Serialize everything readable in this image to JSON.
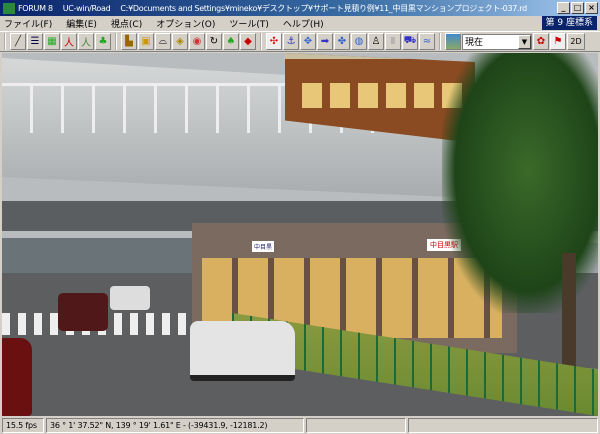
{
  "window": {
    "app": "FORUM 8",
    "product": "UC-win/Road",
    "path": "C:¥Documents and Settings¥mineko¥デスクトップ¥サポート見積り例¥11_中目黒マンションプロジェクト-037.rd",
    "min": "_",
    "max": "□",
    "close": "×"
  },
  "menu": [
    "ファイル(F)",
    "編集(E)",
    "視点(C)",
    "オプション(O)",
    "ツール(T)",
    "ヘルプ(H)"
  ],
  "coord_system": "第 9 座標系",
  "toolbar": {
    "group1": [
      "road-icon",
      "bridge-icon",
      "terrain-icon",
      "person-red-icon",
      "person-walk-icon",
      "tree-icon"
    ],
    "group2": [
      "building-icon",
      "model-icon",
      "tunnel-icon",
      "object-icon",
      "vehicle-icon",
      "rotate-icon",
      "tree-edit-icon",
      "paint-icon"
    ],
    "group3": [
      "target-icon",
      "anchor-icon",
      "move-icon",
      "arrow-icon",
      "compass-icon",
      "globe-icon",
      "driver-icon",
      "pause-icon",
      "car-icon",
      "route-icon"
    ],
    "time_select": "現在",
    "mode_2d": "2D"
  },
  "status": {
    "fps": "15.5 fps",
    "position": "36 °  1' 37.52\"  N, 139 °  19' 1.61\"  E  -  (-39431.9, -12181.2)",
    "field3": "",
    "field4": ""
  },
  "scene": {
    "station_sign": "中目黒駅",
    "station_sign2": "中目黒"
  }
}
